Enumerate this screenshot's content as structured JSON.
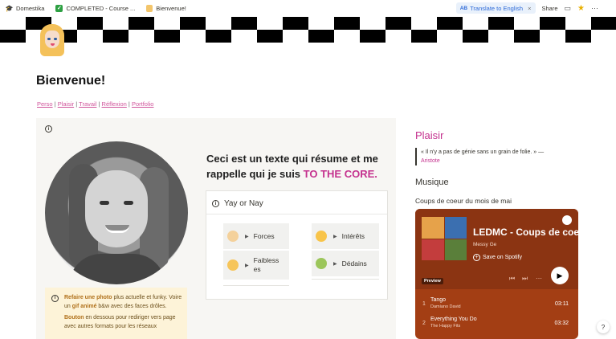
{
  "topbar": {
    "breadcrumbs": [
      {
        "label": "Domestika",
        "icon": "graduation-cap-icon"
      },
      {
        "label": "COMPLETED - Course ...",
        "icon": "check-icon"
      },
      {
        "label": "Bienvenue!",
        "icon": "cartoon-face-icon"
      }
    ],
    "translate_label": "Translate to English",
    "translate_badge": "A͟B",
    "share_label": "Share"
  },
  "page": {
    "title": "Bienvenue!",
    "links": [
      "Perso",
      "Plaisir",
      "Travail",
      "Réflexion",
      "Portfolio"
    ],
    "link_separator": "|"
  },
  "callout": {
    "summary_prefix": "Ceci est un texte qui résume et me rappelle qui je suis ",
    "summary_highlight": "TO THE CORE."
  },
  "yay_or_nay": {
    "heading": "Yay or Nay",
    "items": [
      {
        "label": "Forces",
        "icon": "flexed-bicep-icon"
      },
      {
        "label": "Intérêts",
        "icon": "heart-eyes-icon"
      },
      {
        "label": "Faibless es",
        "icon": "tired-face-icon"
      },
      {
        "label": "Dédains",
        "icon": "nauseated-face-icon"
      }
    ]
  },
  "note": {
    "line1_bold": "Refaire une photo",
    "line1_rest": " plus actuelle et funky. Voire un ",
    "line1_bold2": "gif animé",
    "line1_end": " b&w avec des faces drôles.",
    "line2_bold": "Bouton",
    "line2_rest": " en dessous pour rediriger vers page avec autres formats pour les réseaux"
  },
  "right": {
    "plaisir_heading": "Plaisir",
    "quote_text": "« Il n'y a pas de génie sans un grain de folie. » —",
    "quote_author": "Aristote",
    "musique_heading": "Musique",
    "coups_label": "Coups de coeur du mois de mai"
  },
  "spotify": {
    "title": "LEDMC - Coups de coe",
    "artist": "Messy Ge",
    "save_label": "Save on Spotify",
    "preview_label": "Preview",
    "tracks": [
      {
        "num": "1",
        "title": "Tango",
        "artist": "Damiano David",
        "duration": "03:11"
      },
      {
        "num": "2",
        "title": "Everything You Do",
        "artist": "The Happy Fits",
        "duration": "03:32"
      }
    ]
  },
  "colors": {
    "accent_pink": "#c4318e",
    "link_pink": "#d0559b",
    "callout_bg": "#f7f6f3",
    "note_bg": "#fdf3d8",
    "spotify_bg": "#a33e14"
  }
}
